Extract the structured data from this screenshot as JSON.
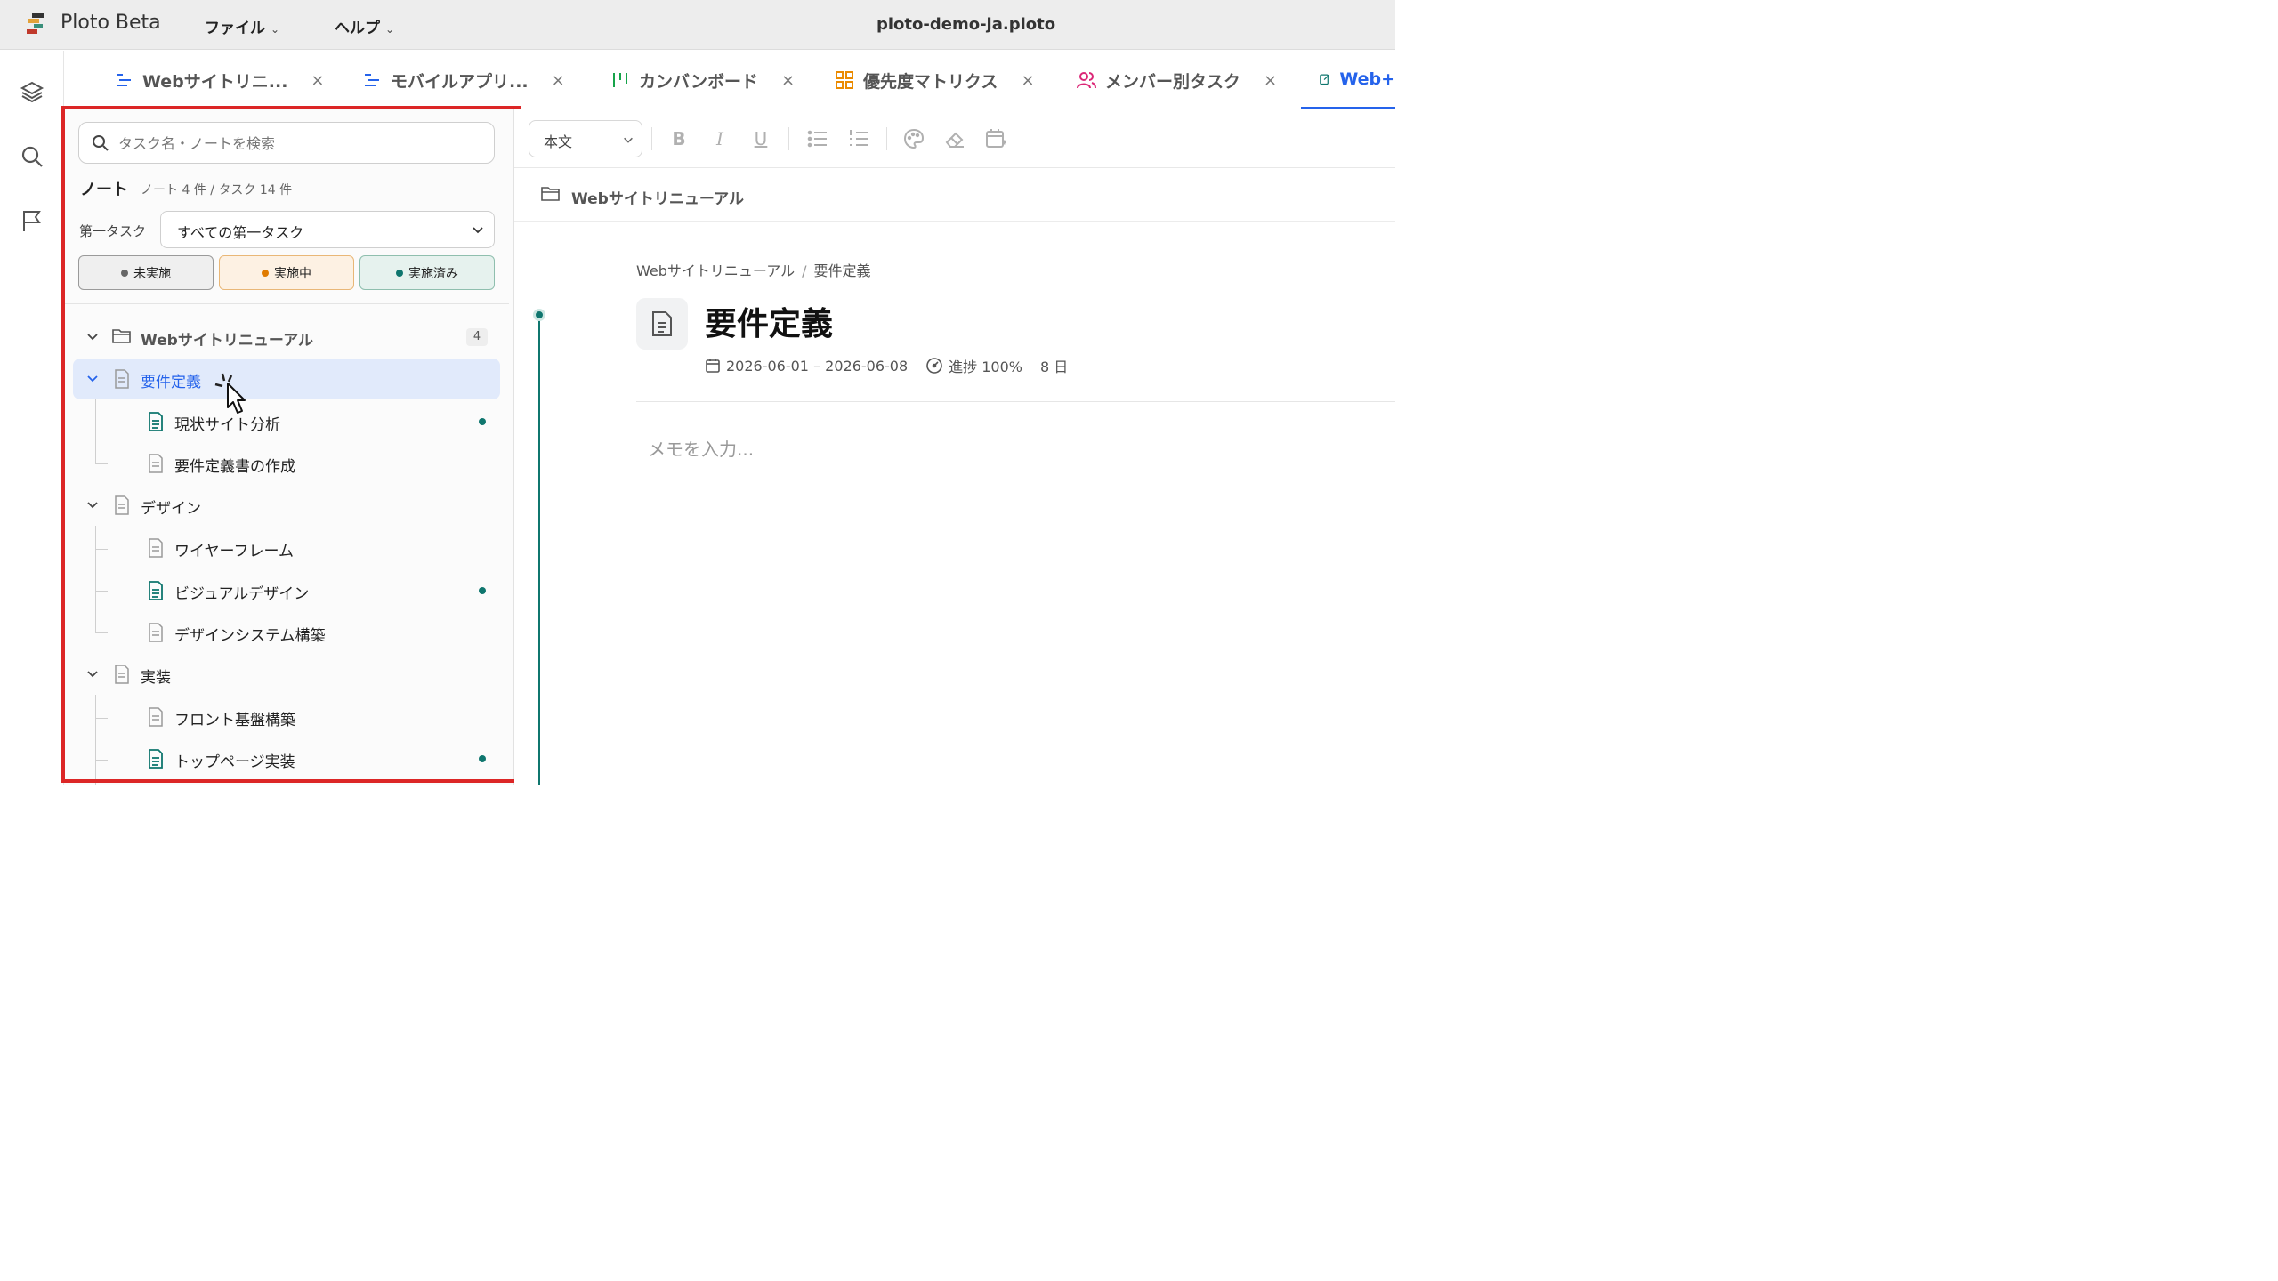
{
  "app": {
    "name": "Ploto Beta",
    "document_title": "ploto-demo-ja.ploto"
  },
  "menus": [
    {
      "label": "ファイル"
    },
    {
      "label": "ヘルプ"
    }
  ],
  "tabs": [
    {
      "label": "Webサイトリニ...",
      "icon": "list-icon",
      "close": "×"
    },
    {
      "label": "モバイルアプリ...",
      "icon": "list-icon",
      "close": "×"
    },
    {
      "label": "カンバンボード",
      "icon": "kanban-icon",
      "close": "×"
    },
    {
      "label": "優先度マトリクス",
      "icon": "grid-icon",
      "close": "×"
    },
    {
      "label": "メンバー別タスク",
      "icon": "users-icon",
      "close": "×"
    },
    {
      "label": "Web+",
      "icon": "note-edit-icon",
      "active": true
    }
  ],
  "rail": [
    "layers-icon",
    "search-icon",
    "flag-icon"
  ],
  "panel": {
    "search_placeholder": "タスク名・ノートを検索",
    "heading": "ノート",
    "count_text": "ノート 4 件 / タスク 14 件",
    "filter_label": "第一タスク",
    "filter_value": "すべての第一タスク",
    "status_filters": [
      {
        "label": "未実施",
        "color": "#666666"
      },
      {
        "label": "実施中",
        "color": "#e07b00"
      },
      {
        "label": "実施済み",
        "color": "#0f766e"
      }
    ],
    "tree": {
      "root": {
        "label": "Webサイトリニューアル",
        "count": "4"
      },
      "items": [
        {
          "label": "要件定義",
          "level": 1,
          "selected": true
        },
        {
          "label": "現状サイト分析",
          "level": 2,
          "has_note": true
        },
        {
          "label": "要件定義書の作成",
          "level": 2
        },
        {
          "label": "デザイン",
          "level": 1
        },
        {
          "label": "ワイヤーフレーム",
          "level": 2
        },
        {
          "label": "ビジュアルデザイン",
          "level": 2,
          "has_note": true
        },
        {
          "label": "デザインシステム構築",
          "level": 2
        },
        {
          "label": "実装",
          "level": 1
        },
        {
          "label": "フロント基盤構築",
          "level": 2
        },
        {
          "label": "トップページ実装",
          "level": 2,
          "has_note": true
        }
      ]
    }
  },
  "editor": {
    "format_select": "本文",
    "toolbar_buttons": [
      "B",
      "I",
      "U",
      "bullet-list-icon",
      "numbered-list-icon",
      "palette-icon",
      "eraser-icon",
      "calendar-add-icon"
    ],
    "crumb": "Webサイトリニューアル",
    "path": [
      "Webサイトリニューアル",
      "要件定義"
    ],
    "path_separator": "/",
    "title": "要件定義",
    "date_range": "2026-06-01 – 2026-06-08",
    "progress": "進捗 100%",
    "duration": "8 日",
    "memo_placeholder": "メモを入力..."
  },
  "colors": {
    "accent": "#2563eb",
    "teal": "#0f766e",
    "highlight_border": "#dc2626"
  }
}
